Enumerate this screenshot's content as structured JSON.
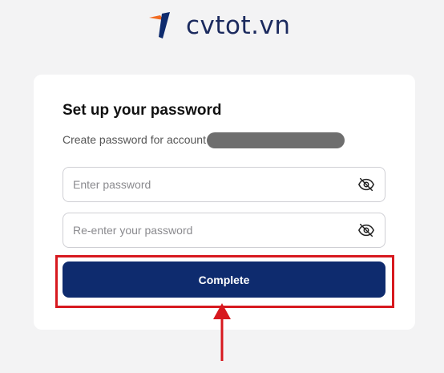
{
  "logo": {
    "text": "cvtot.vn",
    "icon": "cvtot-logo-icon"
  },
  "form": {
    "title": "Set up your password",
    "subtitle": "Create password for account",
    "password": {
      "value": "",
      "placeholder": "Enter password",
      "icon": "eye-off-icon"
    },
    "confirm": {
      "value": "",
      "placeholder": "Re-enter your password",
      "icon": "eye-off-icon"
    },
    "submit_label": "Complete"
  },
  "colors": {
    "brand_navy": "#0e2b6e",
    "brand_orange": "#f26b21",
    "annotation_red": "#d7191f"
  }
}
